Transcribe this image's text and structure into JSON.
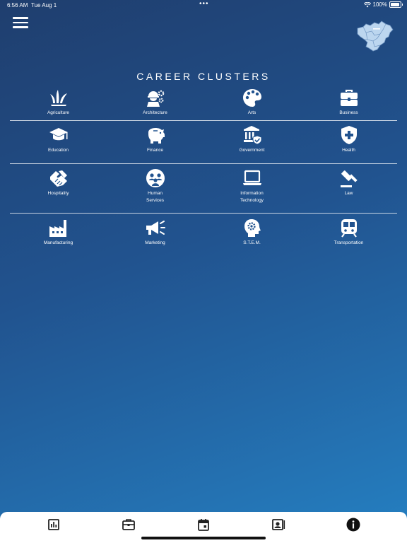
{
  "status_bar": {
    "time": "6:56 AM",
    "date": "Tue Aug 1",
    "battery": "100%"
  },
  "header": {
    "title": "CAREER CLUSTERS"
  },
  "clusters": [
    {
      "label": "Agriculture",
      "icon": "agriculture-icon"
    },
    {
      "label": "Architecture",
      "icon": "architecture-icon"
    },
    {
      "label": "Arts",
      "icon": "arts-palette-icon"
    },
    {
      "label": "Business",
      "icon": "business-briefcase-icon"
    },
    {
      "label": "Education",
      "icon": "education-cap-icon"
    },
    {
      "label": "Finance",
      "icon": "finance-piggy-bank-icon"
    },
    {
      "label": "Government",
      "icon": "government-building-icon"
    },
    {
      "label": "Health",
      "icon": "health-shield-icon"
    },
    {
      "label": "Hospitality",
      "icon": "hospitality-handshake-icon"
    },
    {
      "label": "Human\nServices",
      "icon": "human-services-icon"
    },
    {
      "label": "Information\nTechnology",
      "icon": "laptop-icon"
    },
    {
      "label": "Law",
      "icon": "law-gavel-icon"
    },
    {
      "label": "Manufacturing",
      "icon": "factory-icon"
    },
    {
      "label": "Marketing",
      "icon": "megaphone-icon"
    },
    {
      "label": "S.T.E.M.",
      "icon": "stem-head-gear-icon"
    },
    {
      "label": "Transportation",
      "icon": "train-icon"
    }
  ],
  "tabs": [
    {
      "icon": "chart-icon"
    },
    {
      "icon": "briefcase-icon"
    },
    {
      "icon": "calendar-icon"
    },
    {
      "icon": "contact-card-icon"
    },
    {
      "icon": "info-icon",
      "active": true
    }
  ],
  "colors": {
    "bg_top": "#1f3e6e",
    "bg_bottom": "#2580c2",
    "tab_bar": "#ffffff"
  }
}
